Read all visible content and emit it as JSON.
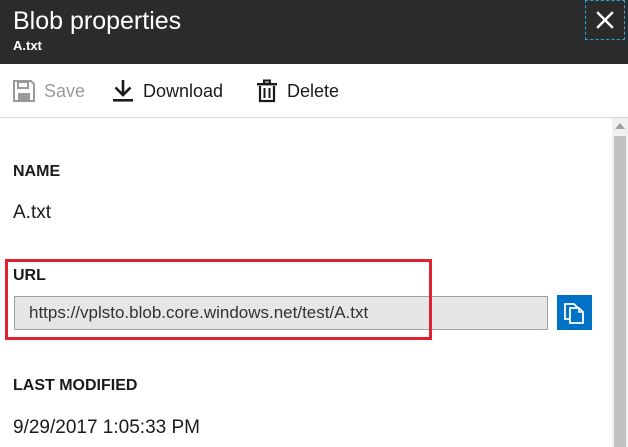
{
  "header": {
    "title": "Blob properties",
    "subtitle": "A.txt",
    "close_icon": "close-icon",
    "focus_outline_color": "#2aa7e0",
    "background": "#2b2b2b"
  },
  "toolbar": {
    "save_label": "Save",
    "save_disabled": true,
    "download_label": "Download",
    "delete_label": "Delete",
    "icons": [
      "save-icon",
      "download-icon",
      "delete-icon"
    ]
  },
  "fields": {
    "name_label": "NAME",
    "name_value": "A.txt",
    "url_label": "URL",
    "url_value": "https://vplsto.blob.core.windows.net/test/A.txt",
    "last_modified_label": "LAST MODIFIED",
    "last_modified_value": "9/29/2017 1:05:33 PM"
  },
  "copy_button": {
    "icon": "copy-icon",
    "color": "#0072c6"
  },
  "highlight": {
    "color": "#e1212f"
  }
}
